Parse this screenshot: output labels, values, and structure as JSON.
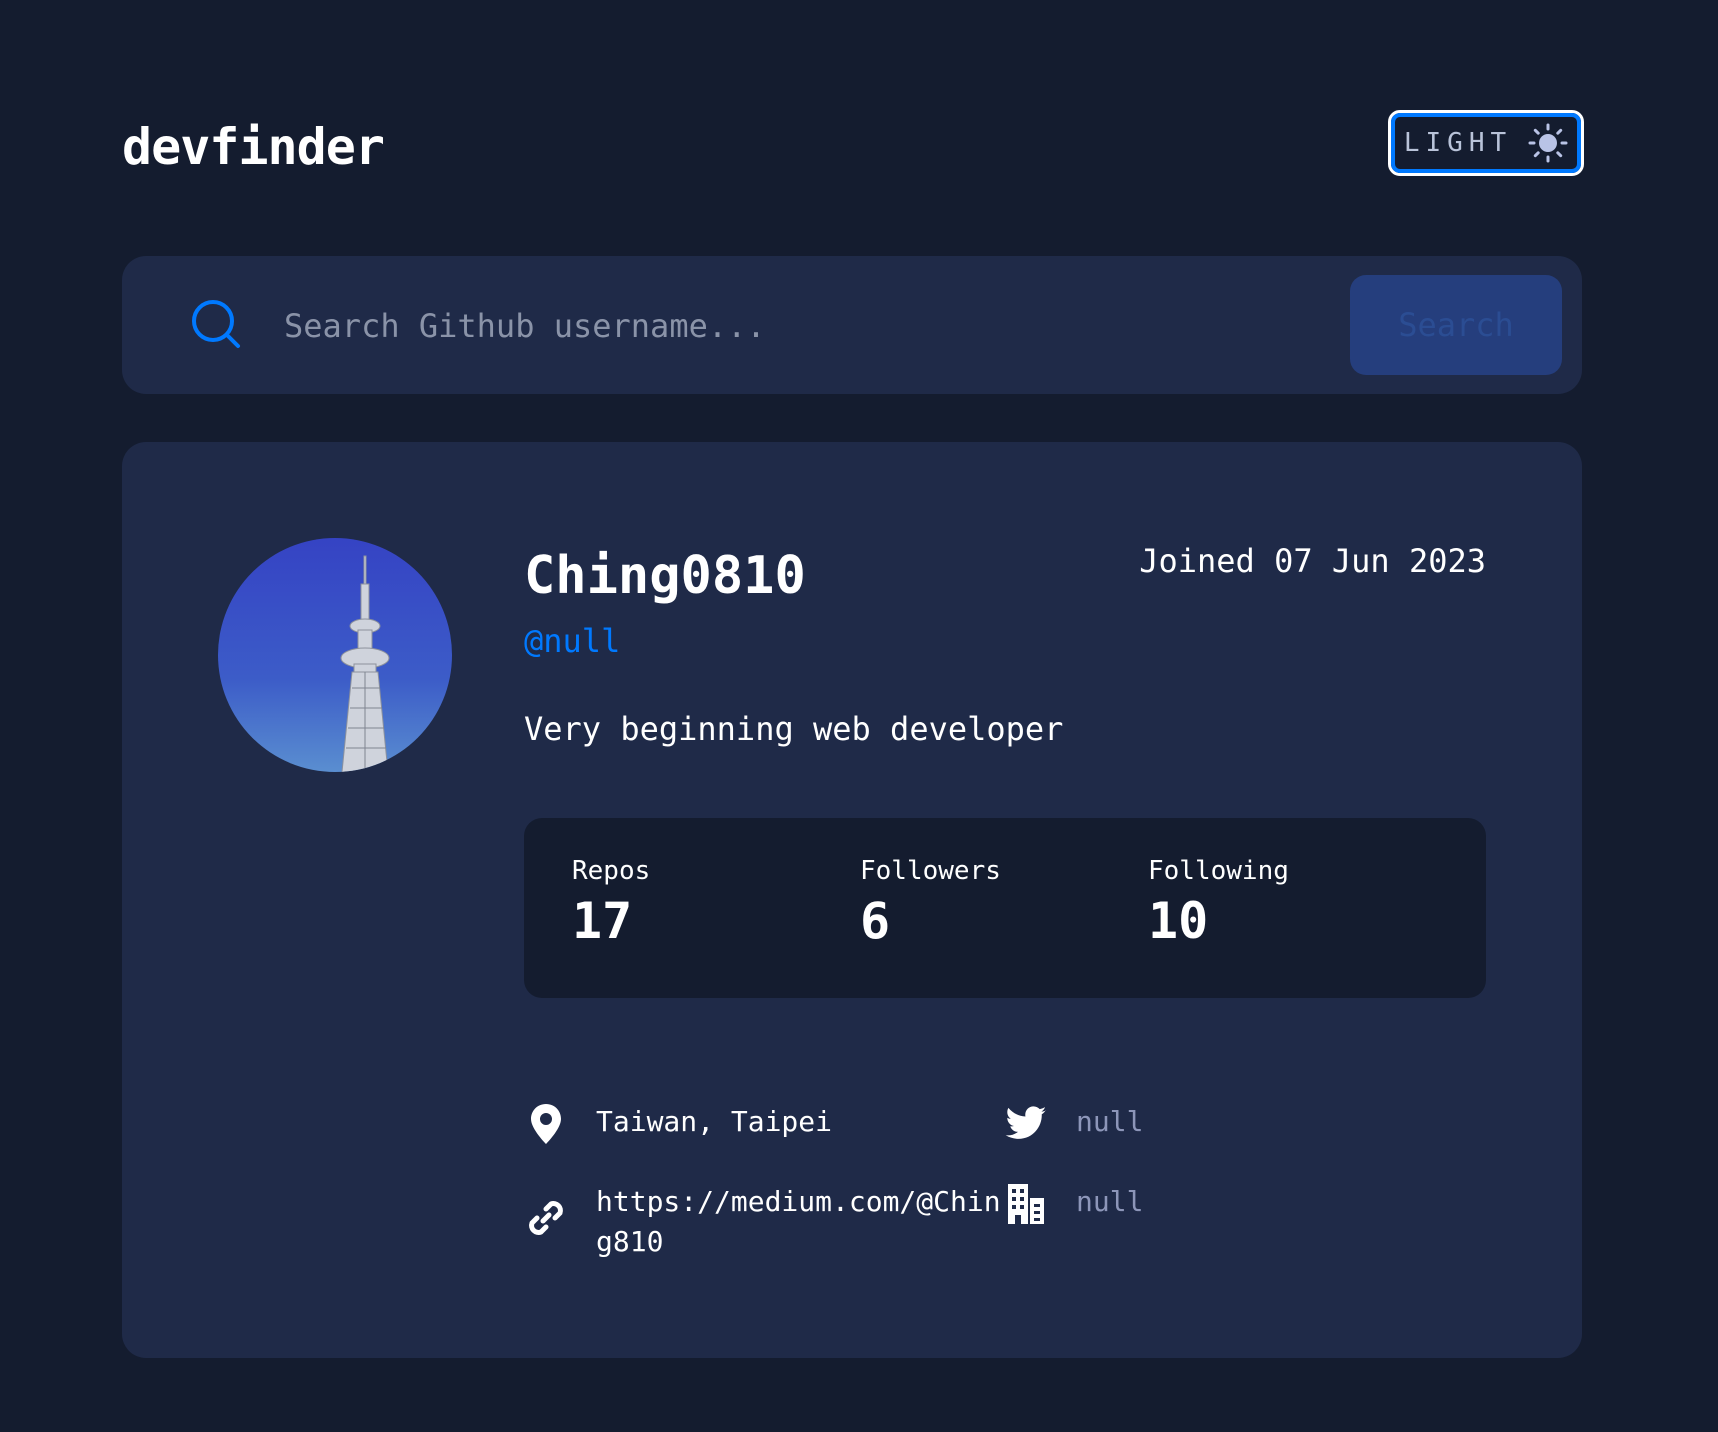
{
  "header": {
    "logo": "devfinder",
    "theme_toggle_label": "LIGHT",
    "theme_icon": "sun-icon"
  },
  "search": {
    "icon": "search-icon",
    "placeholder": "Search Github username...",
    "value": "",
    "button_label": "Search"
  },
  "profile": {
    "name": "Ching0810",
    "handle": "@null",
    "joined": "Joined 07 Jun 2023",
    "bio": "Very beginning web developer",
    "avatar": "Tokyo Skytree tower against blue sky",
    "stats": [
      {
        "label": "Repos",
        "value": "17"
      },
      {
        "label": "Followers",
        "value": "6"
      },
      {
        "label": "Following",
        "value": "10"
      }
    ],
    "links": {
      "location": {
        "icon": "location-pin-icon",
        "text": "Taiwan, Taipei"
      },
      "twitter": {
        "icon": "twitter-icon",
        "text": "null"
      },
      "website": {
        "icon": "link-icon",
        "text": "https://medium.com/@Ching810"
      },
      "company": {
        "icon": "building-icon",
        "text": "null"
      }
    }
  },
  "colors": {
    "background": "#141c2f",
    "card": "#1f2a48",
    "accent": "#0079ff",
    "muted_text": "#8d96b9"
  }
}
